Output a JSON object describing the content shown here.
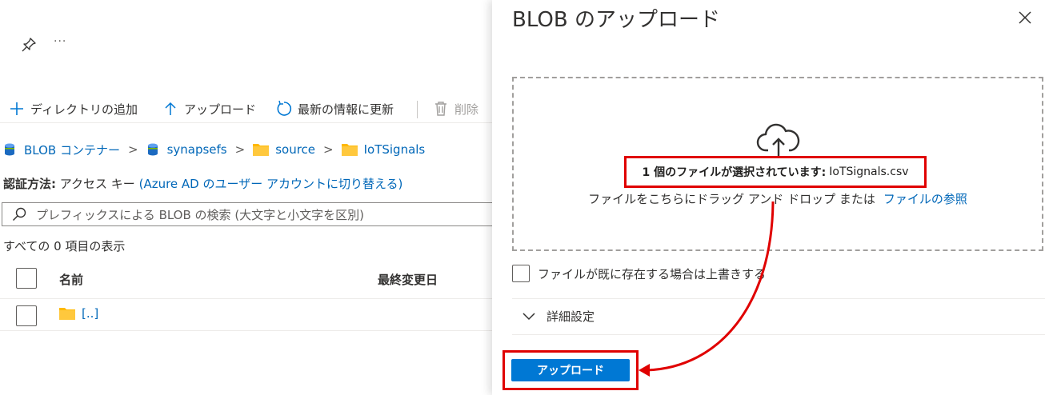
{
  "left": {
    "more_label": "···",
    "toolbar": {
      "add_directory": "ディレクトリの追加",
      "upload": "アップロード",
      "refresh": "最新の情報に更新",
      "delete": "削除"
    },
    "breadcrumb": {
      "items": [
        "BLOB コンテナー",
        "synapsefs",
        "source",
        "IoTSignals"
      ],
      "separator": ">"
    },
    "auth": {
      "label": "認証方法:",
      "value": "アクセス キー",
      "switch_link": "(Azure AD のユーザー アカウントに切り替える)"
    },
    "search": {
      "placeholder": "プレフィックスによる BLOB の検索 (大文字と小文字を区別)"
    },
    "count_text": "すべての 0 項目の表示",
    "table": {
      "columns": [
        "名前",
        "最終変更日"
      ],
      "rows": [
        {
          "name": "[..]"
        }
      ]
    }
  },
  "panel": {
    "title": "BLOB のアップロード",
    "selected": {
      "prefix": "1 個のファイルが選択されています:",
      "filename": "IoTSignals.csv"
    },
    "drop_hint": "ファイルをこちらにドラッグ アンド ドロップ または",
    "browse_link": "ファイルの参照",
    "overwrite_label": "ファイルが既に存在する場合は上書きする",
    "advanced_label": "詳細設定",
    "upload_button": "アップロード"
  },
  "colors": {
    "accent": "#0078d4",
    "link": "#0067b8",
    "highlight": "#e00000",
    "folder": "#ffb900"
  },
  "icons": [
    "pin-icon",
    "add-icon",
    "upload-icon",
    "refresh-icon",
    "delete-icon",
    "storage-icon",
    "folder-icon",
    "search-icon",
    "close-icon",
    "cloud-upload-icon",
    "chevron-down-icon"
  ]
}
